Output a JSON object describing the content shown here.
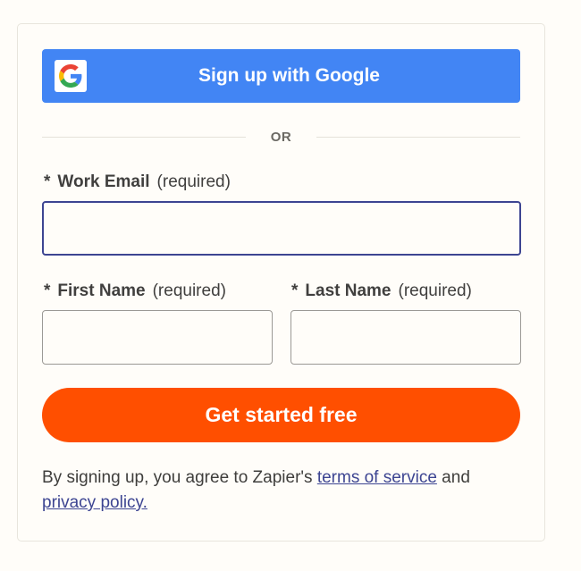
{
  "google_signup": {
    "label": "Sign up with Google",
    "logo_letter": "G"
  },
  "divider": {
    "text": "OR"
  },
  "work_email": {
    "star": "*",
    "label": "Work Email",
    "required_text": "(required)",
    "value": ""
  },
  "first_name": {
    "star": "*",
    "label": "First Name",
    "required_text": "(required)",
    "value": ""
  },
  "last_name": {
    "star": "*",
    "label": "Last Name",
    "required_text": "(required)",
    "value": ""
  },
  "cta": {
    "label": "Get started free"
  },
  "legal": {
    "prefix": "By signing up, you agree to Zapier's ",
    "terms_link": "terms of service",
    "middle": " and",
    "privacy_link": "privacy policy."
  },
  "colors": {
    "google_blue": "#4285f4",
    "cta_orange": "#ff4f00",
    "link": "#3d4592",
    "focus_border": "#3d4592"
  }
}
